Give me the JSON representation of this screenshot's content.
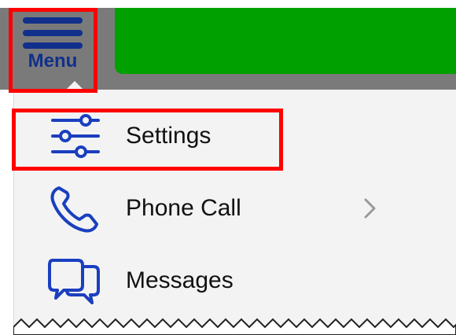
{
  "menu": {
    "button_label": "Menu",
    "items": [
      {
        "label": "Settings",
        "icon": "sliders-icon",
        "has_submenu": false
      },
      {
        "label": "Phone Call",
        "icon": "phone-icon",
        "has_submenu": true
      },
      {
        "label": "Messages",
        "icon": "chat-bubbles-icon",
        "has_submenu": false
      }
    ]
  },
  "colors": {
    "accent": "#10308c",
    "banner": "#00a000",
    "header": "#7a7a7a",
    "highlight": "#ff0000",
    "panel": "#f3f3f3"
  }
}
